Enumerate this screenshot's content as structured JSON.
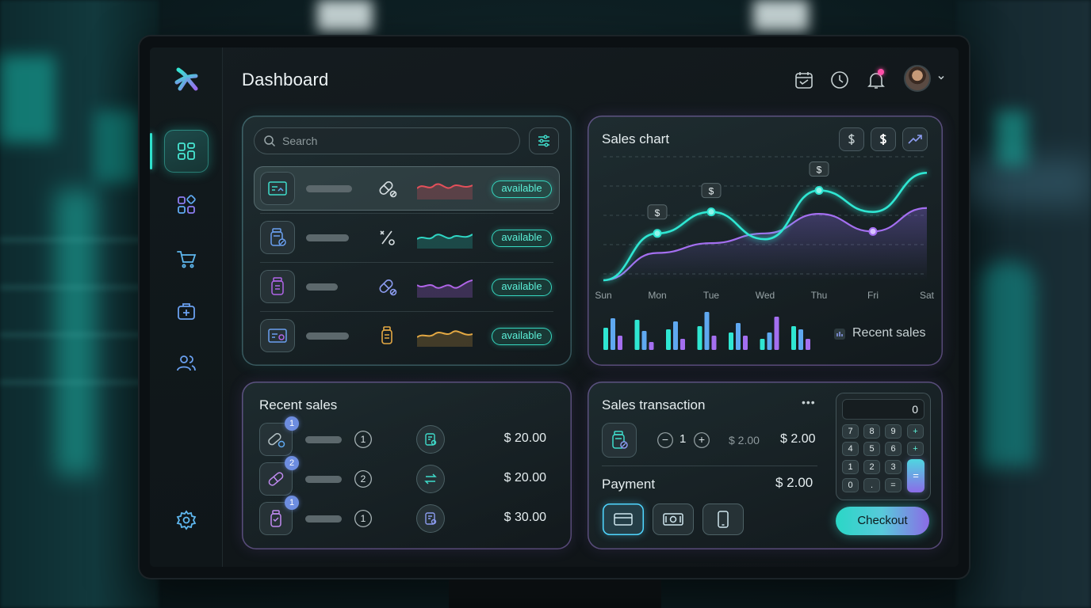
{
  "header": {
    "title": "Dashboard"
  },
  "sidebar": {
    "items": [
      {
        "name": "dashboard",
        "icon": "grid-icon",
        "active": true
      },
      {
        "name": "apps",
        "icon": "apps-icon",
        "active": false
      },
      {
        "name": "cart",
        "icon": "cart-icon",
        "active": false
      },
      {
        "name": "medical-kit",
        "icon": "briefcase-plus-icon",
        "active": false
      },
      {
        "name": "users",
        "icon": "users-icon",
        "active": false
      }
    ],
    "settings_icon": "gear-icon"
  },
  "products": {
    "search_placeholder": "Search",
    "rows": [
      {
        "status": "available",
        "bar_fraction": 0.86,
        "spark_color": "#e4505a"
      },
      {
        "status": "available",
        "bar_fraction": 0.78,
        "spark_color": "#2fd6c4"
      },
      {
        "status": "available",
        "bar_fraction": 0.58,
        "spark_color": "#b065e8"
      },
      {
        "status": "available",
        "bar_fraction": 0.8,
        "spark_color": "#e3a843"
      }
    ]
  },
  "sales_chart": {
    "title": "Sales chart",
    "marker_label": "$",
    "legend_label": "Recent sales"
  },
  "chart_data": {
    "type": "line",
    "title": "Sales chart",
    "categories": [
      "Sun",
      "Mon",
      "Tue",
      "Wed",
      "Thu",
      "Fri",
      "Sat"
    ],
    "series": [
      {
        "values": [
          0,
          48,
          70,
          42,
          92,
          70,
          110
        ],
        "color": "#2fe6d2"
      },
      {
        "values": [
          0,
          28,
          38,
          48,
          68,
          50,
          74
        ],
        "color": "#a46ff0"
      }
    ],
    "ylim": [
      0,
      120
    ],
    "grid": true,
    "bars": {
      "groups": [
        [
          28,
          40,
          18
        ],
        [
          38,
          24,
          10
        ],
        [
          26,
          36,
          14
        ],
        [
          30,
          48,
          18
        ],
        [
          22,
          34,
          18
        ],
        [
          14,
          22,
          42
        ],
        [
          30,
          26,
          14
        ]
      ],
      "colors": [
        "#2fe6d2",
        "#5fa8f0",
        "#a46ff0"
      ]
    }
  },
  "recent_sales": {
    "title": "Recent sales",
    "rows": [
      {
        "badge": "1",
        "qty": "1",
        "price": "$ 20.00",
        "action_icon": "receipt-icon"
      },
      {
        "badge": "2",
        "qty": "2",
        "price": "$ 20.00",
        "action_icon": "swap-icon"
      },
      {
        "badge": "1",
        "qty": "1",
        "price": "$ 30.00",
        "action_icon": "receipt-icon"
      }
    ]
  },
  "transaction": {
    "title": "Sales transaction",
    "more": "•••",
    "qty": "1",
    "unit_price": "$ 2.00",
    "line_total": "$ 2.00",
    "payment_label": "Payment",
    "payment_total": "$ 2.00",
    "minus": "−",
    "plus": "+",
    "checkout_label": "Checkout"
  },
  "calculator": {
    "display": "0",
    "keys": [
      "7",
      "8",
      "9",
      "+",
      "4",
      "5",
      "6",
      "+",
      "1",
      "2",
      "3",
      "0",
      ".",
      "="
    ],
    "equals": "="
  }
}
